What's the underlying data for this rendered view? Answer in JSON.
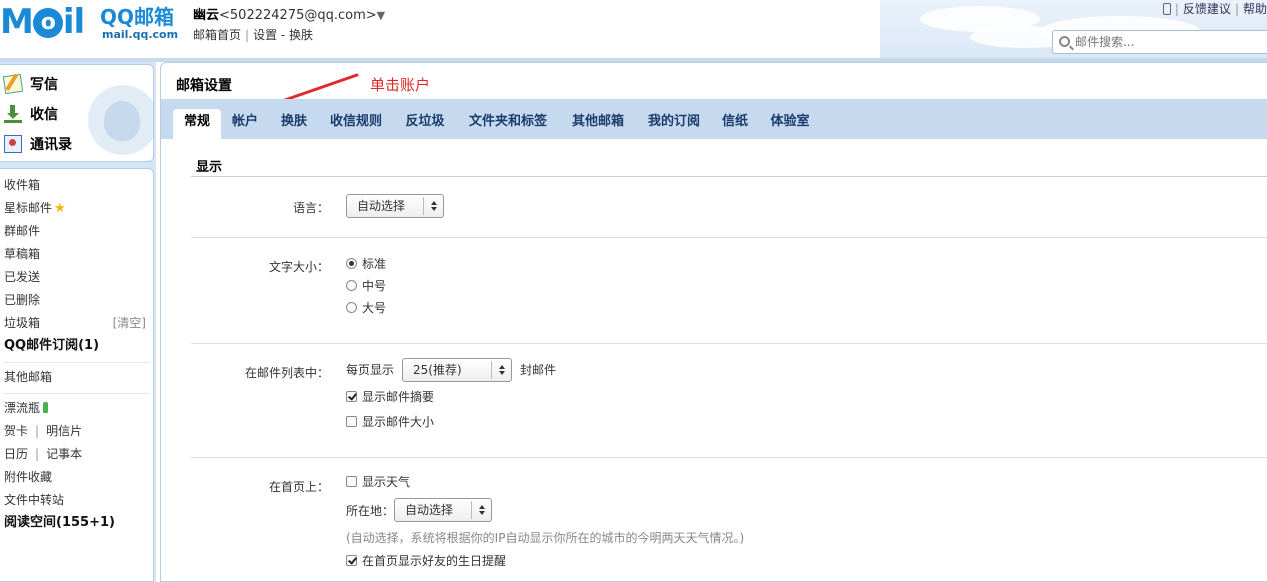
{
  "header": {
    "logo_text": "MOil",
    "brand": "QQ邮箱",
    "domain": "mail.qq.com",
    "user_name": "幽云",
    "user_email": "<502224275@qq.com>",
    "user_caret": "▼",
    "links": [
      "邮箱首页",
      "设置",
      "换肤"
    ],
    "top_right": [
      "反馈建议",
      "帮助"
    ],
    "search_placeholder": "邮件搜索..."
  },
  "sidebar": {
    "quick": [
      {
        "label": "写信",
        "icon": "write-icon"
      },
      {
        "label": "收信",
        "icon": "inbox-icon"
      },
      {
        "label": "通讯录",
        "icon": "contacts-icon"
      }
    ],
    "folders": {
      "inbox": "收件箱",
      "starred": "星标邮件",
      "group": "群邮件",
      "drafts": "草稿箱",
      "sent": "已发送",
      "deleted": "已删除",
      "spam": "垃圾箱",
      "spam_clear": "[清空]",
      "subscription": "QQ邮件订阅(1)",
      "other_mail": "其他邮箱",
      "drift_bottle": "漂流瓶",
      "card": "贺卡",
      "postcard": "明信片",
      "calendar": "日历",
      "notes": "记事本",
      "attachments": "附件收藏",
      "transfer": "文件中转站",
      "reading": "阅读空间(155+1)"
    }
  },
  "main": {
    "title": "邮箱设置",
    "annotation": "单击账户",
    "tabs": [
      "常规",
      "帐户",
      "换肤",
      "收信规则",
      "反垃圾",
      "文件夹和标签",
      "其他邮箱",
      "我的订阅",
      "信纸",
      "体验室"
    ],
    "active_tab": "常规",
    "section_title": "显示",
    "language": {
      "label": "语言：",
      "value": "自动选择"
    },
    "font_size": {
      "label": "文字大小：",
      "options": [
        "标准",
        "中号",
        "大号"
      ],
      "selected": "标准"
    },
    "mail_list": {
      "label": "在邮件列表中：",
      "per_page_prefix": "每页显示",
      "per_page_value": "25(推荐)",
      "per_page_suffix": "封邮件",
      "show_summary": "显示邮件摘要",
      "show_size": "显示邮件大小"
    },
    "homepage": {
      "label": "在首页上：",
      "show_weather": "显示天气",
      "location_label": "所在地：",
      "location_value": "自动选择",
      "weather_hint": "(自动选择，系统将根据你的IP自动显示你所在的城市的今明两天天气情况。)",
      "birthday_reminder": "在首页显示好友的生日提醒"
    }
  }
}
